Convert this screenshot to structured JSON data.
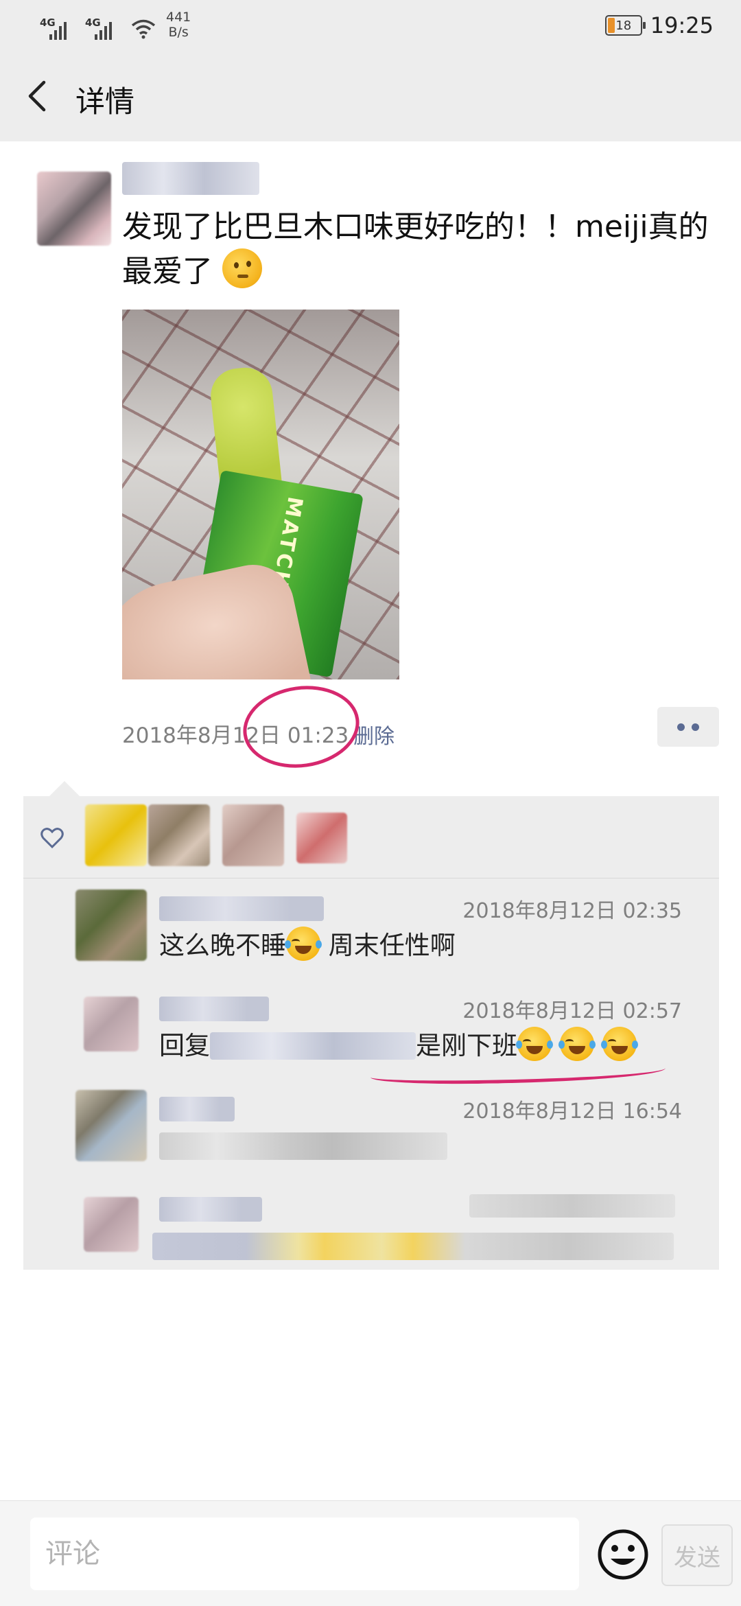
{
  "status_bar": {
    "network_1": "4G",
    "network_2": "4G",
    "speed_value": "441",
    "speed_unit": "B/s",
    "battery": "18",
    "time": "19:25"
  },
  "header": {
    "title": "详情",
    "back_icon": "chevron-left-icon"
  },
  "post": {
    "text": "发现了比巴旦木口味更好吃的！！meiji真的最爱了",
    "emoji": "thinking-face-emoji",
    "photo_label": "MATCHA",
    "timestamp": "2018年8月12日 01:23",
    "delete_label": "删除",
    "more_icon": "more-dots-icon"
  },
  "likes": {
    "icon": "heart-icon"
  },
  "comments": [
    {
      "time": "2018年8月12日 02:35",
      "text_a": "这么晚不睡",
      "text_b": " 周末任性啊"
    },
    {
      "time": "2018年8月12日 02:57",
      "reply_prefix": "回复",
      "text": "是刚下班"
    },
    {
      "time": "2018年8月12日 16:54"
    },
    {}
  ],
  "annotations": {
    "circle_color": "#d6286e",
    "underline_color": "#d6286e"
  },
  "colors": {
    "link": "#5b6b93",
    "background_bar": "#ededed",
    "battery_low": "#e8912a"
  },
  "footer": {
    "input_placeholder": "评论",
    "emoji_icon": "smiley-icon",
    "send_label": "发送"
  }
}
